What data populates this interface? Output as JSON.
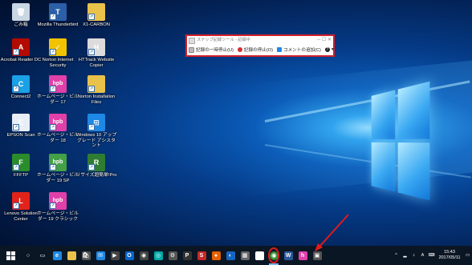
{
  "desktop_icons": [
    {
      "label": "ごみ箱",
      "color": "#c9d6e3",
      "glyph": "🗑"
    },
    {
      "label": "Acrobat Reader DC",
      "color": "#b30b00",
      "glyph": "A"
    },
    {
      "label": "Connect2",
      "color": "#1aa1e6",
      "glyph": "C"
    },
    {
      "label": "EPSON Scan",
      "color": "#e8eef6",
      "glyph": "E"
    },
    {
      "label": "FFFTP",
      "color": "#2a8c2a",
      "glyph": "F"
    },
    {
      "label": "Lenovo Solution Center",
      "color": "#e2231a",
      "glyph": "L"
    },
    {
      "label": "Mozilla Thunderbird",
      "color": "#2b5fa8",
      "glyph": "T"
    },
    {
      "label": "Norton Internet Security",
      "color": "#f2c200",
      "glyph": "✓"
    },
    {
      "label": "ホームページ・ビルダー 17",
      "color": "#e040a8",
      "glyph": "hpb"
    },
    {
      "label": "ホームページ・ビルダー 18",
      "color": "#e040a8",
      "glyph": "hpb"
    },
    {
      "label": "ホームページ・ビルダー 19 SP",
      "color": "#43a047",
      "glyph": "hpb"
    },
    {
      "label": "ホームページ・ビルダー 19 クラシック",
      "color": "#e040a8",
      "glyph": "hpb"
    },
    {
      "label": "X1-CARBON",
      "color": "#e8c24a",
      "glyph": ""
    },
    {
      "label": "HTTrack Website Copier",
      "color": "#dcdcdc",
      "glyph": "H"
    },
    {
      "label": "Norton Installation Files",
      "color": "#e8c24a",
      "glyph": ""
    },
    {
      "label": "Windows 10 アップグレード アシスタント",
      "color": "#1e88e5",
      "glyph": "⊞"
    },
    {
      "label": "リサイズ超簡単!Pro",
      "color": "#2f7d32",
      "glyph": "R"
    }
  ],
  "snip_window": {
    "title": "スナップ記録ツール - 記録中",
    "pause_label": "記録の一時停止(U)",
    "stop_label": "記録の停止(O)",
    "comment_label": "コメントの追加(C)",
    "help_glyph": "?"
  },
  "taskbar": {
    "start_icon": "windows-start-icon",
    "items": [
      {
        "name": "search-icon",
        "glyph": "○",
        "color": "transparent"
      },
      {
        "name": "task-view-icon",
        "glyph": "▭",
        "color": "transparent"
      },
      {
        "name": "edge-icon",
        "glyph": "e",
        "color": "#1e88e5"
      },
      {
        "name": "file-explorer-icon",
        "glyph": "",
        "color": "#e8c24a"
      },
      {
        "name": "store-icon",
        "glyph": "🛍",
        "color": "#555"
      },
      {
        "name": "mail-icon",
        "glyph": "✉",
        "color": "#1e88e5"
      },
      {
        "name": "media-icon",
        "glyph": "▶",
        "color": "#444"
      },
      {
        "name": "outlook-icon",
        "glyph": "O",
        "color": "#0a64c8"
      },
      {
        "name": "app-icon",
        "glyph": "◉",
        "color": "#444"
      },
      {
        "name": "app-icon-2",
        "glyph": "◎",
        "color": "#0aa"
      },
      {
        "name": "settings-icon",
        "glyph": "⚙",
        "color": "#555"
      },
      {
        "name": "app-icon-3",
        "glyph": "P",
        "color": "#333"
      },
      {
        "name": "app-icon-4",
        "glyph": "S",
        "color": "#c62828"
      },
      {
        "name": "firefox-icon",
        "glyph": "●",
        "color": "#e66000"
      },
      {
        "name": "app-icon-5",
        "glyph": "◐",
        "color": "#1565c0"
      },
      {
        "name": "calculator-icon",
        "glyph": "▦",
        "color": "#666"
      },
      {
        "name": "app-icon-6",
        "glyph": "◻",
        "color": "#fff"
      },
      {
        "name": "steps-recorder-taskbar-icon",
        "glyph": "◉",
        "color": "#2e7d32",
        "highlight": true,
        "active": true
      },
      {
        "name": "app-icon-7",
        "glyph": "W",
        "color": "#2b579a"
      },
      {
        "name": "hpb-taskbar-icon",
        "glyph": "h",
        "color": "#e040a8"
      },
      {
        "name": "app-icon-8",
        "glyph": "▣",
        "color": "#555"
      }
    ]
  },
  "tray": {
    "chevron": "^",
    "ime": "A",
    "time": "15:43",
    "date": "2017/05/11"
  }
}
